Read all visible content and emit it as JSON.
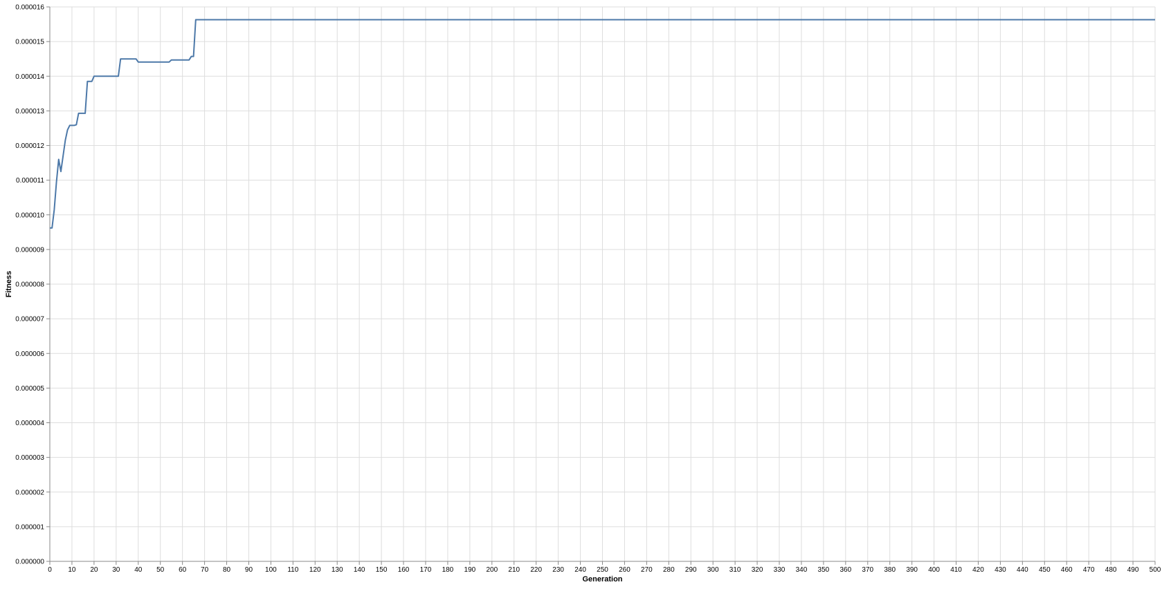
{
  "chart_data": {
    "type": "line",
    "xlabel": "Generation",
    "ylabel": "Fitness",
    "xlim": [
      0,
      500
    ],
    "ylim": [
      0,
      1.6e-05
    ],
    "x_ticks": [
      0,
      10,
      20,
      30,
      40,
      50,
      60,
      70,
      80,
      90,
      100,
      110,
      120,
      130,
      140,
      150,
      160,
      170,
      180,
      190,
      200,
      210,
      220,
      230,
      240,
      250,
      260,
      270,
      280,
      290,
      300,
      310,
      320,
      330,
      340,
      350,
      360,
      370,
      380,
      390,
      400,
      410,
      420,
      430,
      440,
      450,
      460,
      470,
      480,
      490,
      500
    ],
    "y_ticks": [
      0,
      1e-06,
      2e-06,
      3e-06,
      4e-06,
      5e-06,
      6e-06,
      7e-06,
      8e-06,
      9e-06,
      1e-05,
      1.1e-05,
      1.2e-05,
      1.3e-05,
      1.4e-05,
      1.5e-05,
      1.6e-05
    ],
    "y_tick_labels": [
      "0.000000",
      "0.000001",
      "0.000002",
      "0.000003",
      "0.000004",
      "0.000005",
      "0.000006",
      "0.000007",
      "0.000008",
      "0.000009",
      "0.000010",
      "0.000011",
      "0.000012",
      "0.000013",
      "0.000014",
      "0.000015",
      "0.000016"
    ],
    "grid": true,
    "legend": "none",
    "line_color": "#4c78a8",
    "series": [
      {
        "x": [
          0,
          1,
          2,
          3,
          4,
          5,
          6,
          7,
          8,
          9,
          10,
          11,
          12,
          13,
          14,
          15,
          16,
          17,
          18,
          19,
          20,
          21,
          22,
          23,
          24,
          25,
          26,
          27,
          28,
          29,
          30,
          31,
          32,
          33,
          34,
          35,
          36,
          37,
          38,
          39,
          40,
          41,
          42,
          43,
          44,
          45,
          46,
          47,
          48,
          49,
          50,
          51,
          52,
          53,
          54,
          55,
          56,
          57,
          58,
          59,
          60,
          61,
          62,
          63,
          64,
          65,
          66,
          67,
          68,
          69,
          70,
          100,
          200,
          300,
          400,
          500
        ],
        "values": [
          9.62e-06,
          9.62e-06,
          1.015e-05,
          1.095e-05,
          1.16e-05,
          1.125e-05,
          1.17e-05,
          1.215e-05,
          1.245e-05,
          1.258e-05,
          1.258e-05,
          1.258e-05,
          1.26e-05,
          1.293e-05,
          1.293e-05,
          1.293e-05,
          1.293e-05,
          1.385e-05,
          1.385e-05,
          1.385e-05,
          1.4e-05,
          1.4e-05,
          1.4e-05,
          1.4e-05,
          1.4e-05,
          1.4e-05,
          1.4e-05,
          1.4e-05,
          1.4e-05,
          1.4e-05,
          1.4e-05,
          1.4e-05,
          1.45e-05,
          1.45e-05,
          1.45e-05,
          1.45e-05,
          1.45e-05,
          1.45e-05,
          1.45e-05,
          1.45e-05,
          1.441e-05,
          1.441e-05,
          1.441e-05,
          1.441e-05,
          1.441e-05,
          1.441e-05,
          1.441e-05,
          1.441e-05,
          1.441e-05,
          1.441e-05,
          1.441e-05,
          1.441e-05,
          1.441e-05,
          1.441e-05,
          1.441e-05,
          1.447e-05,
          1.447e-05,
          1.447e-05,
          1.447e-05,
          1.447e-05,
          1.447e-05,
          1.447e-05,
          1.447e-05,
          1.447e-05,
          1.457e-05,
          1.457e-05,
          1.563e-05,
          1.563e-05,
          1.563e-05,
          1.563e-05,
          1.563e-05,
          1.563e-05,
          1.563e-05,
          1.563e-05,
          1.563e-05,
          1.563e-05
        ]
      }
    ]
  }
}
